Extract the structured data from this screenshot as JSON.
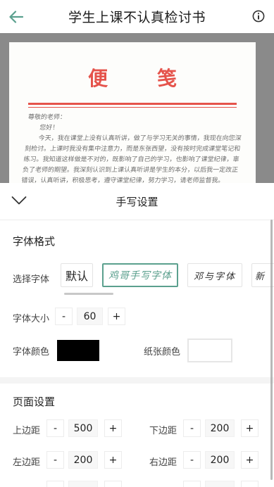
{
  "header": {
    "title": "学生上课不认真检讨书",
    "back_icon": "arrow-left-icon",
    "info_icon": "info-icon",
    "accent": "#5ba08e"
  },
  "preview": {
    "paper_title": "便笺",
    "paper_title_color": "#e5534b",
    "paper_text": "尊敬的老师：\n　　您好！\n　　今天，我在课堂上没有认真听讲，做了与学习无关的事情，我现在向您深刻检讨。上课时我没有集中注意力，而是东张西望，没有按时完成课堂笔记和练习。我知道这样做是不对的，既影响了自己的学习，也影响了课堂纪律，辜负了老师的期望。我深刻认识到上课认真听讲是学生的本分，以后我一定改正错误，认真听讲，积极思考，遵守课堂纪律，努力学习，请老师监督我。"
  },
  "panel": {
    "title": "手写设置",
    "collapse_icon": "chevron-down-icon",
    "font_section": {
      "title": "字体格式",
      "select_font_label": "选择字体",
      "fonts": [
        "默认",
        "鸡哥手写字体",
        "邓与字体",
        "新"
      ],
      "selected_font": "鸡哥手写字体",
      "size_label": "字体大小",
      "size_value": "60",
      "color_label": "字体颜色",
      "font_color": "#000000",
      "paper_color_label": "纸张颜色",
      "paper_color": "#ffffff"
    },
    "page_section": {
      "title": "页面设置",
      "top_margin_label": "上边距",
      "top_margin": "500",
      "bottom_margin_label": "下边距",
      "bottom_margin": "200",
      "left_margin_label": "左边距",
      "left_margin": "200",
      "right_margin_label": "右边距",
      "right_margin": "200"
    },
    "minus": "-",
    "plus": "+"
  }
}
